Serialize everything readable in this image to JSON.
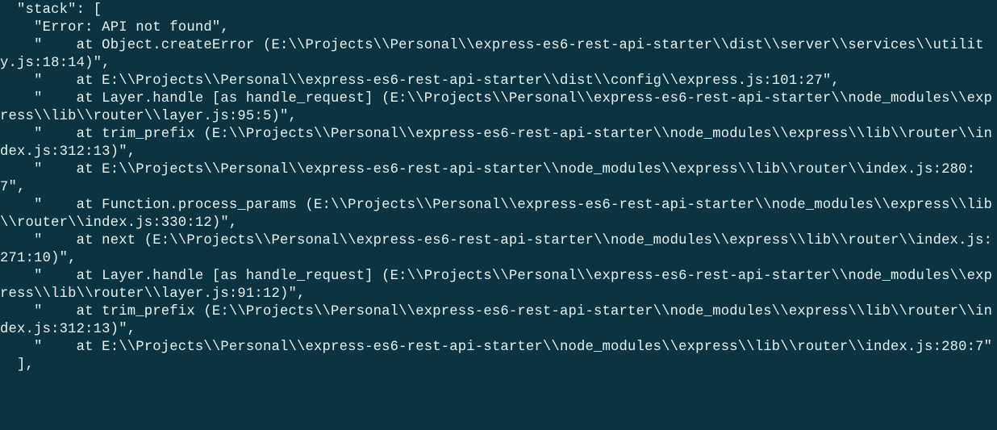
{
  "terminal": {
    "indent_key": "  \"stack\": [",
    "lines": [
      "    \"Error: API not found\",",
      "    \"    at Object.createError (E:\\\\Projects\\\\Personal\\\\express-es6-rest-api-starter\\\\dist\\\\server\\\\services\\\\utility.js:18:14)\",",
      "    \"    at E:\\\\Projects\\\\Personal\\\\express-es6-rest-api-starter\\\\dist\\\\config\\\\express.js:101:27\",",
      "    \"    at Layer.handle [as handle_request] (E:\\\\Projects\\\\Personal\\\\express-es6-rest-api-starter\\\\node_modules\\\\express\\\\lib\\\\router\\\\layer.js:95:5)\",",
      "    \"    at trim_prefix (E:\\\\Projects\\\\Personal\\\\express-es6-rest-api-starter\\\\node_modules\\\\express\\\\lib\\\\router\\\\index.js:312:13)\",",
      "    \"    at E:\\\\Projects\\\\Personal\\\\express-es6-rest-api-starter\\\\node_modules\\\\express\\\\lib\\\\router\\\\index.js:280:7\",",
      "    \"    at Function.process_params (E:\\\\Projects\\\\Personal\\\\express-es6-rest-api-starter\\\\node_modules\\\\express\\\\lib\\\\router\\\\index.js:330:12)\",",
      "    \"    at next (E:\\\\Projects\\\\Personal\\\\express-es6-rest-api-starter\\\\node_modules\\\\express\\\\lib\\\\router\\\\index.js:271:10)\",",
      "    \"    at Layer.handle [as handle_request] (E:\\\\Projects\\\\Personal\\\\express-es6-rest-api-starter\\\\node_modules\\\\express\\\\lib\\\\router\\\\layer.js:91:12)\",",
      "    \"    at trim_prefix (E:\\\\Projects\\\\Personal\\\\express-es6-rest-api-starter\\\\node_modules\\\\express\\\\lib\\\\router\\\\index.js:312:13)\",",
      "    \"    at E:\\\\Projects\\\\Personal\\\\express-es6-rest-api-starter\\\\node_modules\\\\express\\\\lib\\\\router\\\\index.js:280:7\"",
      "  ],"
    ]
  }
}
